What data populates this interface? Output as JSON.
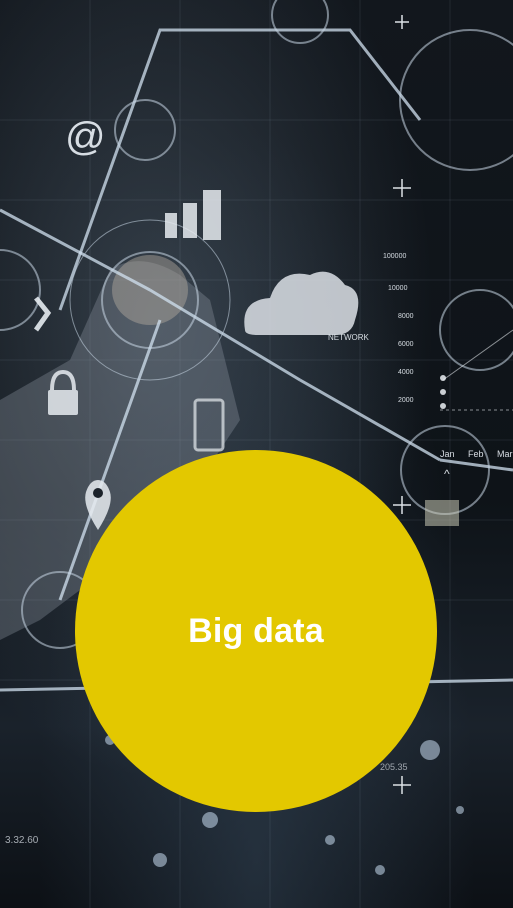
{
  "circle": {
    "label": "Big data",
    "color": "#e3c800"
  },
  "overlay": {
    "network_label": "NETWORK",
    "chart_axis_values": [
      "100000",
      "10000",
      "8000",
      "6000",
      "4000",
      "2000"
    ],
    "month_labels": [
      "Jan",
      "Feb",
      "Mar"
    ],
    "bottom_readout": "3.32.60",
    "ip_fragment": "205.35"
  },
  "icons": [
    "at-sign-icon",
    "bar-chart-icon",
    "cloud-icon",
    "lock-icon",
    "location-pin-icon",
    "chevron-right-icon",
    "mobile-phone-icon",
    "plus-icon"
  ]
}
